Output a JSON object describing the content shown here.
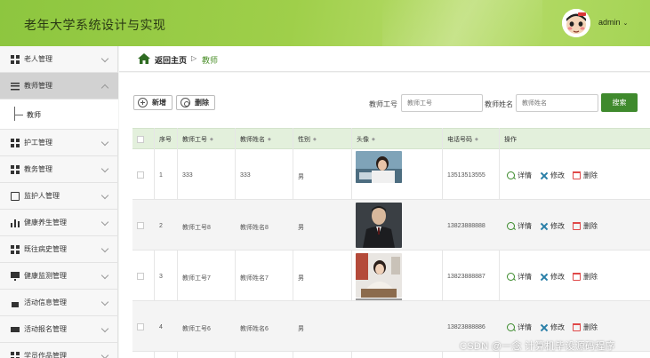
{
  "header": {
    "title": "老年大学系统设计与实现",
    "user": "admin"
  },
  "sidebar": {
    "items": [
      {
        "label": "老人管理",
        "icon": "grid-icon"
      },
      {
        "label": "教师管理",
        "icon": "list-icon",
        "open": true
      },
      {
        "label": "护工管理",
        "icon": "grid-icon"
      },
      {
        "label": "教务管理",
        "icon": "grid-icon"
      },
      {
        "label": "监护人管理",
        "icon": "checkbox-icon"
      },
      {
        "label": "健康养生管理",
        "icon": "bar-chart-icon"
      },
      {
        "label": "既往病史管理",
        "icon": "grid-icon"
      },
      {
        "label": "健康监测管理",
        "icon": "monitor-icon"
      },
      {
        "label": "活动信息管理",
        "icon": "clipboard-icon"
      },
      {
        "label": "活动报名管理",
        "icon": "ticket-icon"
      },
      {
        "label": "学员作品管理",
        "icon": "grid-icon"
      }
    ],
    "sub_item": "教师"
  },
  "breadcrumb": {
    "home": "返回主页",
    "separator": "▷",
    "current": "教师"
  },
  "toolbar": {
    "add_label": "新增",
    "delete_label": "删除",
    "filter_no_label": "教师工号",
    "filter_no_placeholder": "教师工号",
    "filter_name_label": "教师姓名",
    "filter_name_placeholder": "教师姓名",
    "search_label": "搜索"
  },
  "table": {
    "columns": [
      "序号",
      "教师工号",
      "教师姓名",
      "性别",
      "头像",
      "电话号码",
      "操作"
    ],
    "rows": [
      {
        "index": "1",
        "no": "333",
        "name": "333",
        "gender": "男",
        "phone": "13513513555"
      },
      {
        "index": "2",
        "no": "教师工号8",
        "name": "教师姓名8",
        "gender": "男",
        "phone": "13823888888"
      },
      {
        "index": "3",
        "no": "教师工号7",
        "name": "教师姓名7",
        "gender": "男",
        "phone": "13823888887"
      },
      {
        "index": "4",
        "no": "教师工号6",
        "name": "教师姓名6",
        "gender": "男",
        "phone": "13823888886"
      }
    ],
    "actions": {
      "detail": "详情",
      "edit": "修改",
      "delete": "删除"
    }
  },
  "watermark": "CSDN @一念 计算机毕设源码程序",
  "colors": {
    "header_green": "#8dc63f",
    "accent_green": "#3f8a2d",
    "table_header": "#e3f0dc",
    "delete_red": "#e04848"
  }
}
